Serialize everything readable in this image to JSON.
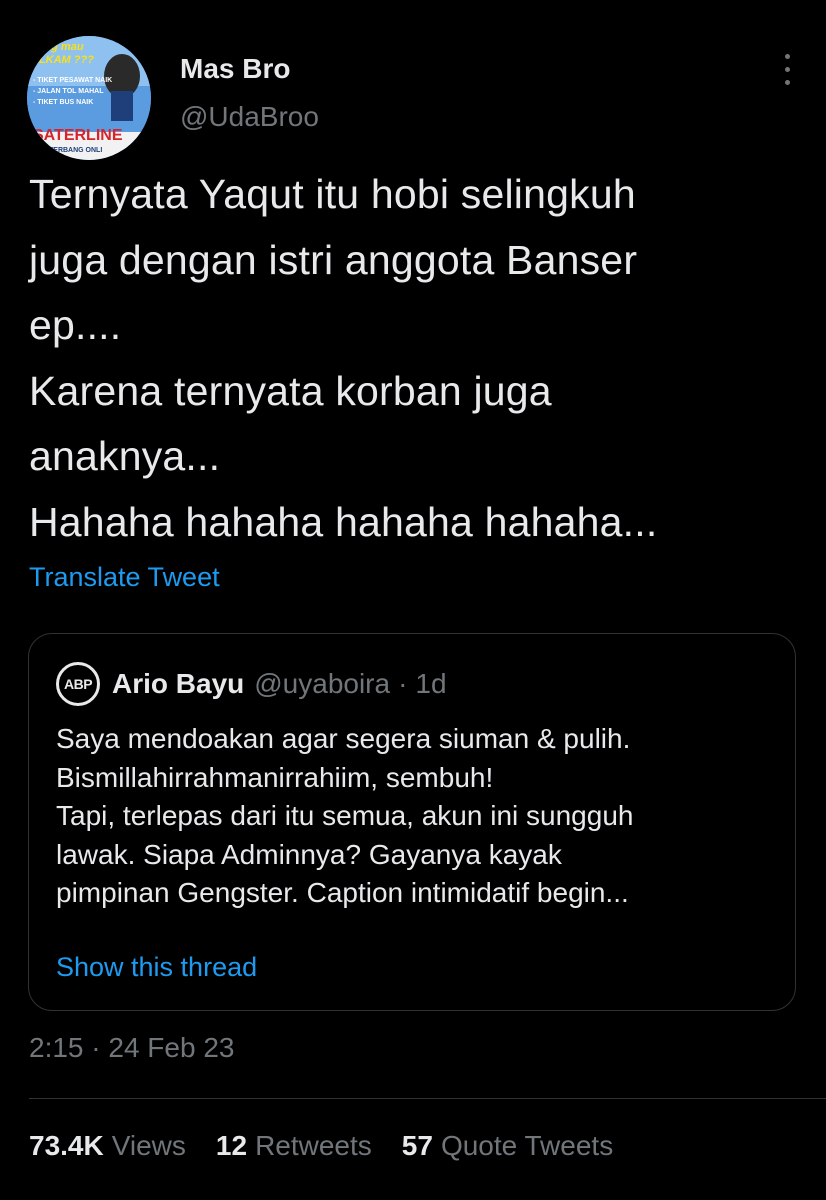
{
  "tweet": {
    "author": {
      "display_name": "Mas Bro",
      "handle": "@UdaBroo",
      "avatar_lines": [
        "gung mau",
        "ULKAM ???",
        "- TIKET PESAWAT NAIK",
        "- JALAN TOL MAHAL",
        "- TIKET BUS NAIK",
        "SATERLINE",
        "TERBANG ONLI"
      ]
    },
    "more_icon": "more-vertical-icon",
    "text": "Ternyata Yaqut itu hobi selingkuh\njuga dengan istri anggota Banser\nep....\nKarena ternyata korban juga\nanaknya...\nHahaha hahaha hahaha hahaha...",
    "translate_label": "Translate Tweet",
    "timestamp": "2:15 · 24 Feb 23"
  },
  "quote": {
    "avatar_text": "ABP",
    "name": "Ario Bayu",
    "handle": "@uyaboira",
    "separator": "·",
    "time": "1d",
    "text": "Saya mendoakan agar segera siuman & pulih.\nBismillahirrahmanirrahiim, sembuh!\nTapi, terlepas dari itu semua, akun ini sungguh\nlawak. Siapa Adminnya? Gayanya kayak\npimpinan Gengster. Caption intimidatif begin...",
    "show_thread_label": "Show this thread"
  },
  "stats": [
    {
      "count": "73.4K",
      "label": "Views"
    },
    {
      "count": "12",
      "label": "Retweets"
    },
    {
      "count": "57",
      "label": "Quote Tweets"
    }
  ],
  "colors": {
    "background": "#000000",
    "text": "#e7e9ea",
    "secondary": "#71767b",
    "link": "#1d9bf0",
    "border": "#2f3336"
  }
}
